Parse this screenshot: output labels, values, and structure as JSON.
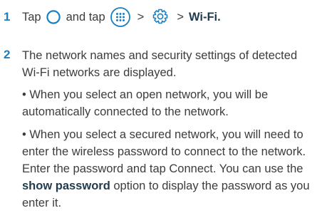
{
  "step1": {
    "number": "1",
    "text_tap": "Tap",
    "text_and_tap": "and tap",
    "arrow1": ">",
    "arrow2": ">",
    "wifi_label": "Wi-Fi.",
    "icons": [
      "home-circle-icon",
      "apps-icon",
      "gear-icon"
    ]
  },
  "step2": {
    "number": "2",
    "intro": "The network names and security settings of detected Wi-Fi networks are displayed.",
    "bullet_open": "• When you select an open network, you will be automatically connected to the network.",
    "bullet_secured_before": "• When you select a secured network, you will need to enter the wireless password to connect to the network. Enter the password and tap Connect. You can use the ",
    "bullet_secured_bold": "show password",
    "bullet_secured_after": " option to display the password as you enter it."
  },
  "colors": {
    "accent": "#1b7fc2",
    "text": "#3c3c3c",
    "bold_text": "#1f3b4d"
  }
}
